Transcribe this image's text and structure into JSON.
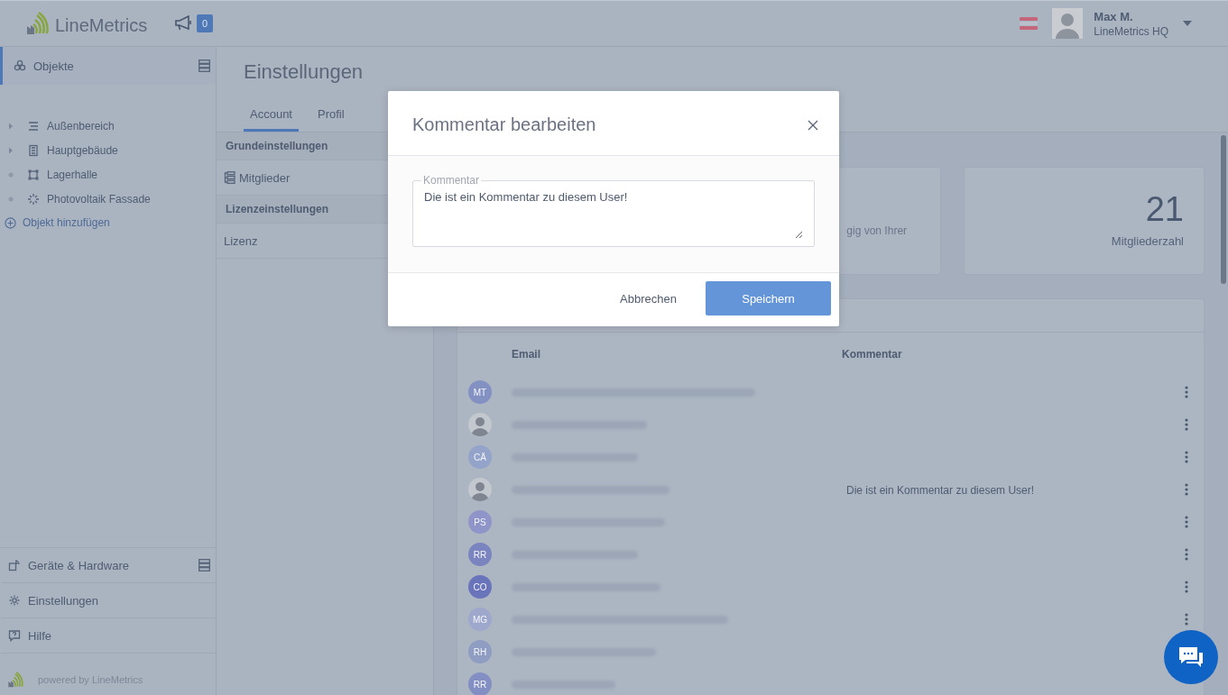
{
  "header": {
    "logo_text": "LineMetrics",
    "notification_count": "0",
    "user": {
      "name": "Max M.",
      "org": "LineMetrics HQ"
    }
  },
  "sidebar": {
    "top": [
      {
        "label": "Objekte",
        "kind": "objects",
        "selected": true
      }
    ],
    "objects": [
      {
        "label": "Außenbereich",
        "kind": "area",
        "expandable": true
      },
      {
        "label": "Hauptgebäude",
        "kind": "building",
        "expandable": true
      },
      {
        "label": "Lagerhalle",
        "kind": "hall",
        "expandable": false
      },
      {
        "label": "Photovoltaik Fassade",
        "kind": "solar",
        "expandable": false
      }
    ],
    "add_object": "Objekt hinzufügen",
    "bottom": [
      {
        "label": "Geräte & Hardware",
        "kind": "devices",
        "selected": false
      },
      {
        "label": "Einstellungen",
        "kind": "settings",
        "selected": false
      },
      {
        "label": "Hilfe",
        "kind": "help",
        "selected": false
      }
    ],
    "powered_by": "powered by LineMetrics"
  },
  "page_title": "Einstellungen",
  "tabs": [
    {
      "label": "Account",
      "selected": true
    },
    {
      "label": "Profil",
      "selected": false
    }
  ],
  "settings_menu": [
    {
      "kind": "section",
      "label": "Grundeinstellungen"
    },
    {
      "kind": "members",
      "label": "Mitglieder"
    },
    {
      "kind": "section",
      "label": "Lizenzeinstellungen"
    },
    {
      "kind": "item",
      "label": "Lizenz"
    }
  ],
  "cards": [
    {
      "text": "gig von Ihrer"
    },
    {
      "value": "21",
      "label": "Mitgliederzahl"
    }
  ],
  "members": {
    "columns": [
      "Email",
      "Kommentar"
    ],
    "rows": [
      {
        "kind": "initials",
        "initials": "MT",
        "color": "#8290c2"
      },
      {
        "kind": "photo"
      },
      {
        "kind": "initials",
        "initials": "CÄ",
        "color": "#93a3c9"
      },
      {
        "kind": "photo",
        "comment": "Die ist ein Kommentar zu diesem User!"
      },
      {
        "kind": "initials",
        "initials": "PS",
        "color": "#8f95c8"
      },
      {
        "kind": "initials",
        "initials": "RR",
        "color": "#7a85c0"
      },
      {
        "kind": "initials",
        "initials": "CO",
        "color": "#6a74ba"
      },
      {
        "kind": "initials",
        "initials": "MG",
        "color": "#9ea7cc"
      },
      {
        "kind": "initials",
        "initials": "RH",
        "color": "#8f9dc2"
      },
      {
        "kind": "initials",
        "initials": "RR",
        "color": "#838ec3"
      }
    ]
  },
  "dialog": {
    "title": "Kommentar bearbeiten",
    "field_label": "Kommentar",
    "field_value": "Die ist ein Kommentar zu diesem User!",
    "cancel": "Abbrechen",
    "save": "Speichern"
  }
}
